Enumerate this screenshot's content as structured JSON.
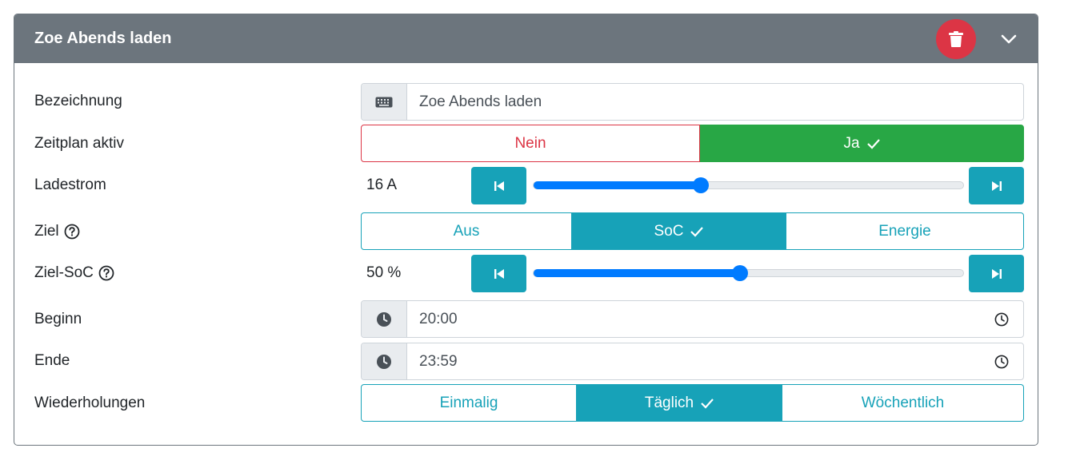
{
  "header": {
    "title": "Zoe Abends laden"
  },
  "fields": {
    "bezeichnung": {
      "label": "Bezeichnung",
      "value": "Zoe Abends laden"
    },
    "zeitplan": {
      "label": "Zeitplan aktiv",
      "options": [
        "Nein",
        "Ja"
      ],
      "selected": "Ja"
    },
    "ladestrom": {
      "label": "Ladestrom",
      "value_text": "16 A",
      "slider_fraction": 0.39
    },
    "ziel": {
      "label": "Ziel",
      "options": [
        "Aus",
        "SoC",
        "Energie"
      ],
      "selected": "SoC"
    },
    "ziel_soc": {
      "label": "Ziel-SoC",
      "value_text": "50 %",
      "slider_fraction": 0.48
    },
    "beginn": {
      "label": "Beginn",
      "value": "20:00"
    },
    "ende": {
      "label": "Ende",
      "value": "23:59"
    },
    "wiederholungen": {
      "label": "Wiederholungen",
      "options": [
        "Einmalig",
        "Täglich",
        "Wöchentlich"
      ],
      "selected": "Täglich"
    }
  },
  "colors": {
    "header_bg": "#6c757d",
    "danger": "#dc3545",
    "success": "#28a745",
    "info": "#17a2b8",
    "primary": "#007bff"
  },
  "icons": [
    "trash-icon",
    "chevron-down-icon",
    "keyboard-icon",
    "help-circle-icon",
    "skip-back-icon",
    "skip-forward-icon",
    "clock-icon",
    "check-icon"
  ]
}
